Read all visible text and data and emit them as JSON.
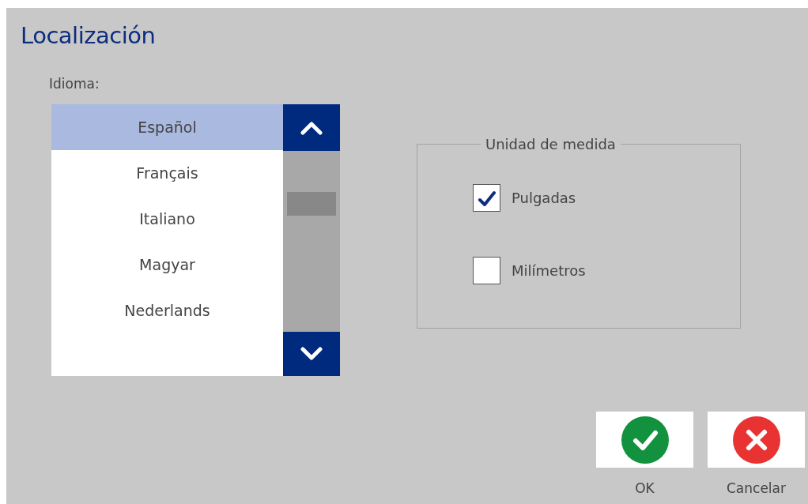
{
  "title": "Localización",
  "language": {
    "label": "Idioma:",
    "items": [
      {
        "label": "Español",
        "selected": true
      },
      {
        "label": "Français",
        "selected": false
      },
      {
        "label": "Italiano",
        "selected": false
      },
      {
        "label": "Magyar",
        "selected": false
      },
      {
        "label": "Nederlands",
        "selected": false
      }
    ]
  },
  "unit_group": {
    "legend": "Unidad de medida",
    "options": [
      {
        "label": "Pulgadas",
        "checked": true
      },
      {
        "label": "Milímetros",
        "checked": false
      }
    ]
  },
  "buttons": [
    {
      "kind": "ok",
      "label": "OK"
    },
    {
      "kind": "cancel",
      "label": "Cancelar"
    }
  ]
}
